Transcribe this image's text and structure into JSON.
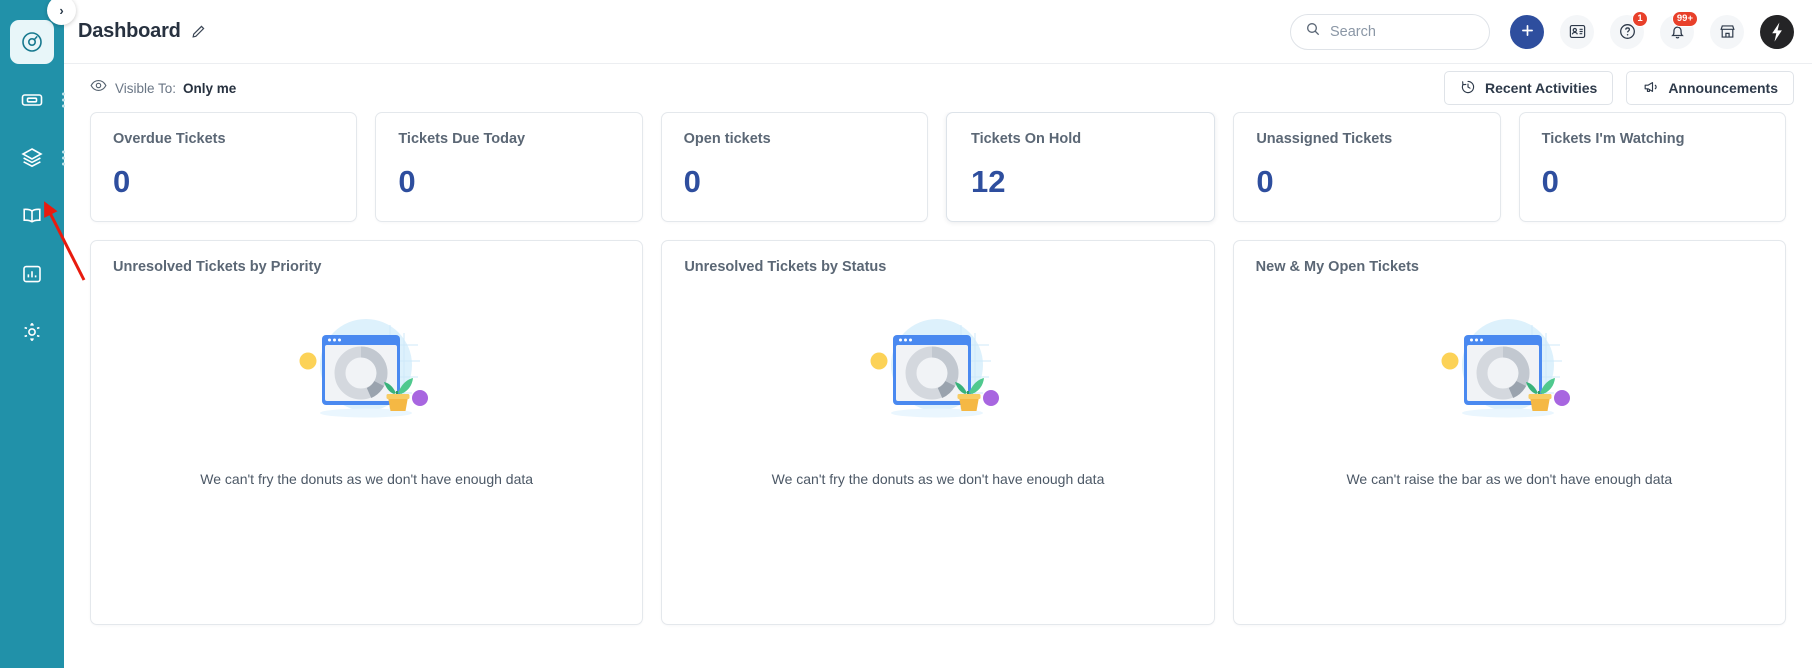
{
  "sidebar": {
    "collapse_label": "›",
    "items": [
      {
        "label": "Dashboard",
        "icon": "gauge-icon",
        "active": true,
        "has_menu": false
      },
      {
        "label": "Tickets",
        "icon": "ticket-icon",
        "active": false,
        "has_menu": true
      },
      {
        "label": "Layers",
        "icon": "layers-icon",
        "active": false,
        "has_menu": true
      },
      {
        "label": "Knowledge Base",
        "icon": "book-icon",
        "active": false,
        "has_menu": false
      },
      {
        "label": "Reports",
        "icon": "bar-chart-icon",
        "active": false,
        "has_menu": false
      },
      {
        "label": "Admin",
        "icon": "gear-icon",
        "active": false,
        "has_menu": false
      }
    ],
    "bg_color": "#2191a9"
  },
  "header": {
    "title": "Dashboard",
    "edit_icon": "pencil-icon",
    "search": {
      "placeholder": "Search",
      "value": "",
      "icon": "search-icon"
    },
    "add_button": {
      "label": "+",
      "icon": "plus-icon",
      "color": "#2e4e9e"
    },
    "icons": [
      {
        "name": "contacts-icon",
        "badge": ""
      },
      {
        "name": "help-icon",
        "badge": "1"
      },
      {
        "name": "bell-icon",
        "badge": "99+"
      },
      {
        "name": "marketplace-icon",
        "badge": ""
      }
    ],
    "avatar": {
      "name": "user-avatar",
      "glyph": "⚡",
      "bg": "#242426"
    },
    "badge_color": "#e8402a"
  },
  "visibility_bar": {
    "eye_icon": "eye-icon",
    "label": "Visible To:",
    "value": "Only me",
    "buttons": [
      {
        "label": "Recent Activities",
        "icon": "history-icon"
      },
      {
        "label": "Announcements",
        "icon": "megaphone-icon"
      }
    ]
  },
  "kpi_cards": [
    {
      "title": "Overdue Tickets",
      "value": "0",
      "highlight": false
    },
    {
      "title": "Tickets Due Today",
      "value": "0",
      "highlight": false
    },
    {
      "title": "Open tickets",
      "value": "0",
      "highlight": false
    },
    {
      "title": "Tickets On Hold",
      "value": "12",
      "highlight": true
    },
    {
      "title": "Unassigned Tickets",
      "value": "0",
      "highlight": false
    },
    {
      "title": "Tickets I'm Watching",
      "value": "0",
      "highlight": false
    }
  ],
  "chart_cards": [
    {
      "title": "Unresolved Tickets by Priority",
      "empty_message": "We can't fry the donuts as we don't have enough data",
      "illustration": "empty-donut-illustration"
    },
    {
      "title": "Unresolved Tickets by Status",
      "empty_message": "We can't fry the donuts as we don't have enough data",
      "illustration": "empty-donut-illustration"
    },
    {
      "title": "New & My Open Tickets",
      "empty_message": "We can't raise the bar as we don't have enough data",
      "illustration": "empty-donut-illustration"
    }
  ],
  "annotation": {
    "arrow_color": "#e81b0e",
    "points_at": "sidebar-item-knowledge-base"
  },
  "chart_data": [
    {
      "type": "pie",
      "title": "Unresolved Tickets by Priority",
      "categories": [],
      "values": [],
      "empty": true
    },
    {
      "type": "pie",
      "title": "Unresolved Tickets by Status",
      "categories": [],
      "values": [],
      "empty": true
    },
    {
      "type": "bar",
      "title": "New & My Open Tickets",
      "categories": [],
      "values": [],
      "empty": true
    }
  ]
}
